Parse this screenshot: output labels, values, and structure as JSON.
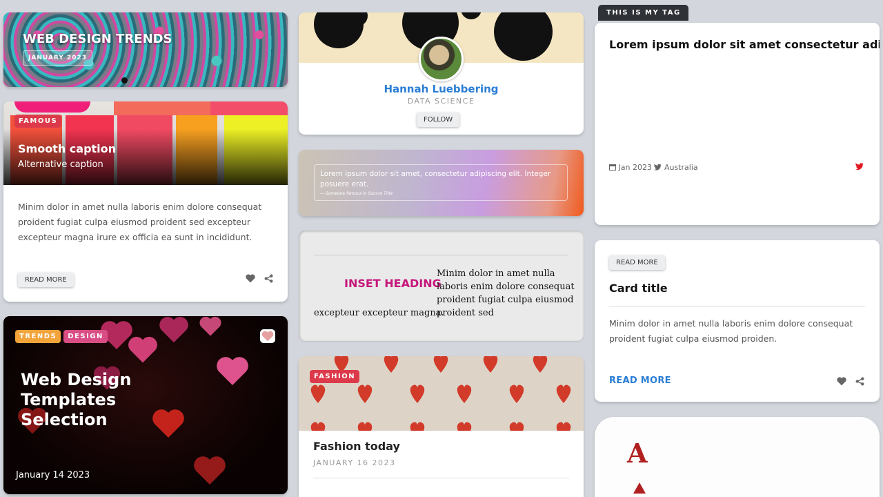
{
  "colors": {
    "background": "#d3d7dd",
    "accent_blue": "#2a7dd4",
    "tag_red": "#dc3a4a",
    "tag_orange": "#f2a33a",
    "tag_pink": "#d94d85",
    "inset_heading": "#c5167a",
    "tag_dark": "#2f3236",
    "twitter_red": "#e01a22"
  },
  "card_trends": {
    "title": "WEB DESIGN TRENDS",
    "date": "JANUARY 2023"
  },
  "card_caption": {
    "tag": "FAMOUS",
    "caption": "Smooth caption",
    "alt_caption": "Alternative caption",
    "body": "Minim dolor in amet nulla laboris enim dolore consequat proident fugiat culpa eiusmod proident sed excepteur excepteur magna irure ex officia ea sunt in incididunt.",
    "button": "READ MORE",
    "icons": [
      "heart-icon",
      "share-icon"
    ]
  },
  "card_templates": {
    "tags": [
      "TRENDS",
      "DESIGN"
    ],
    "title": "Web Design Templates Selection",
    "date": "January 14 2023",
    "icon": "heart-icon"
  },
  "card_profile": {
    "name": "Hannah Luebbering",
    "role": "DATA SCIENCE",
    "button": "FOLLOW"
  },
  "card_quote": {
    "quote": "Lorem ipsum dolor sit amet, consectetur adipiscing elit. Integer posuere erat.",
    "cite": "— Someone famous in Source Title"
  },
  "card_inset": {
    "heading": "INSET HEADING",
    "text_right": "Minim dolor in amet nulla laboris enim dolore consequat proident fugiat culpa eiusmod proident sed",
    "text_bottom": "excepteur excepteur magna."
  },
  "card_fashion": {
    "tag": "FASHION",
    "title": "Fashion today",
    "date": "JANUARY 16 2023"
  },
  "card_tagged": {
    "tab": "THIS IS MY TAG",
    "title": "Lorem ipsum dolor sit amet consectetur adipisi",
    "date": "Jan 2023",
    "location": "Australia",
    "icons": [
      "calendar-icon",
      "twitter-icon"
    ]
  },
  "card_title": {
    "button": "READ MORE",
    "title": "Card title",
    "body": "Minim dolor in amet nulla laboris enim dolore consequat proident fugiat culpa eiusmod proiden.",
    "link": "READ MORE",
    "icons": [
      "heart-icon",
      "share-icon"
    ]
  },
  "card_ace": {
    "letter": "A",
    "suit": "spade-icon"
  }
}
